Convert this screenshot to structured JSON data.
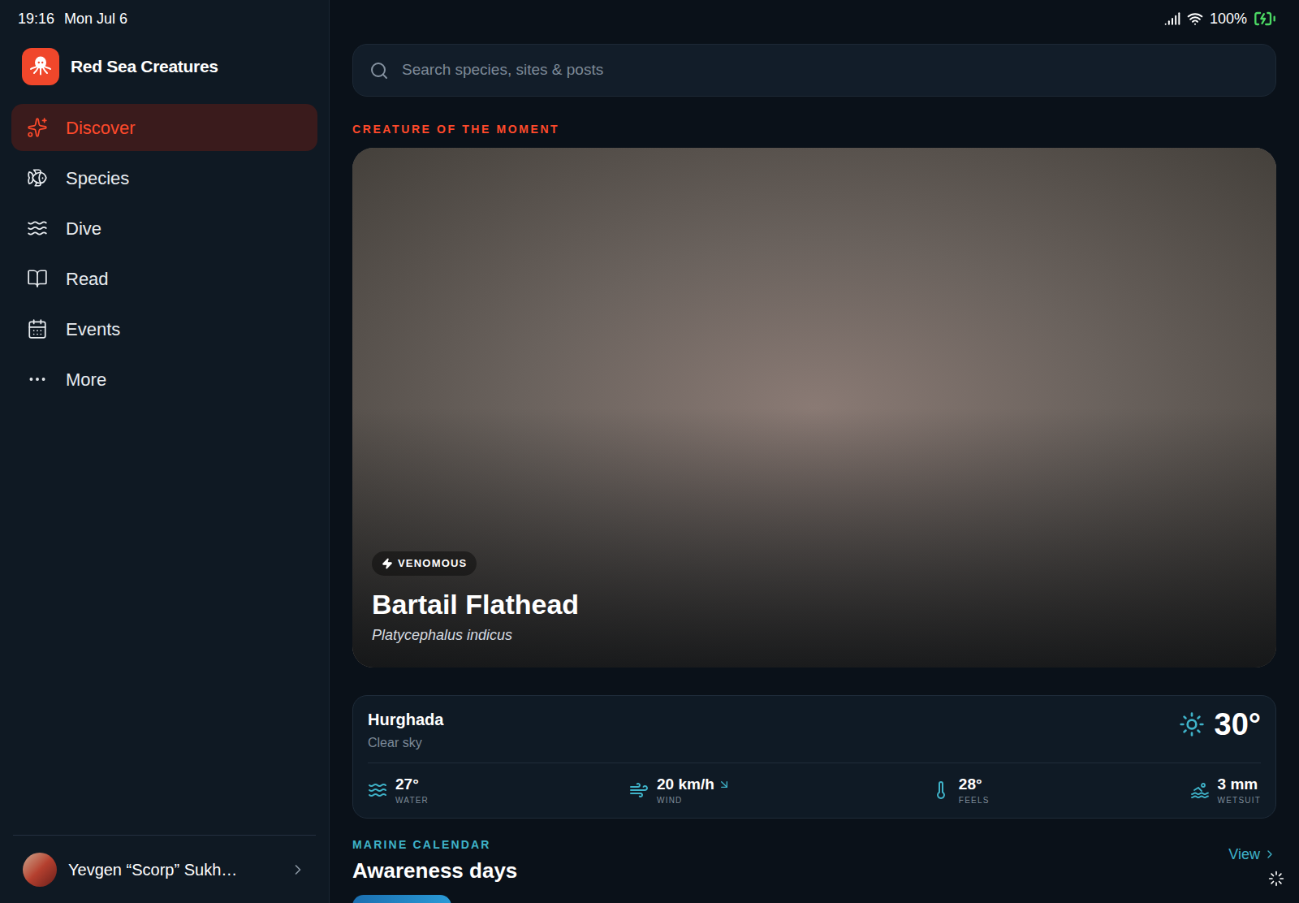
{
  "status_bar": {
    "time": "19:16",
    "date": "Mon Jul 6",
    "battery": "100%",
    "charging": true
  },
  "app": {
    "name": "Red Sea Creatures"
  },
  "sidebar": {
    "items": [
      {
        "label": "Discover",
        "selected": true
      },
      {
        "label": "Species",
        "selected": false
      },
      {
        "label": "Dive",
        "selected": false
      },
      {
        "label": "Read",
        "selected": false
      },
      {
        "label": "Events",
        "selected": false
      },
      {
        "label": "More",
        "selected": false
      }
    ],
    "user": {
      "name": "Yevgen “Scorp” Sukh…"
    }
  },
  "search": {
    "placeholder": "Search species, sites & posts"
  },
  "featured": {
    "section": "CREATURE OF THE MOMENT",
    "badge": "VENOMOUS",
    "name": "Bartail Flathead",
    "scientific_name": "Platycephalus indicus"
  },
  "weather": {
    "location": "Hurghada",
    "condition": "Clear sky",
    "temperature": "30°",
    "stats": [
      {
        "kind": "water",
        "value": "27°",
        "label": "WATER"
      },
      {
        "kind": "wind",
        "value": "20 km/h",
        "label": "WIND"
      },
      {
        "kind": "feels",
        "value": "28°",
        "label": "FEELS"
      },
      {
        "kind": "wetsuit",
        "value": "3 mm",
        "label": "WETSUIT"
      }
    ]
  },
  "calendar": {
    "section": "MARINE CALENDAR",
    "title": "Awareness days",
    "link": "View"
  }
}
